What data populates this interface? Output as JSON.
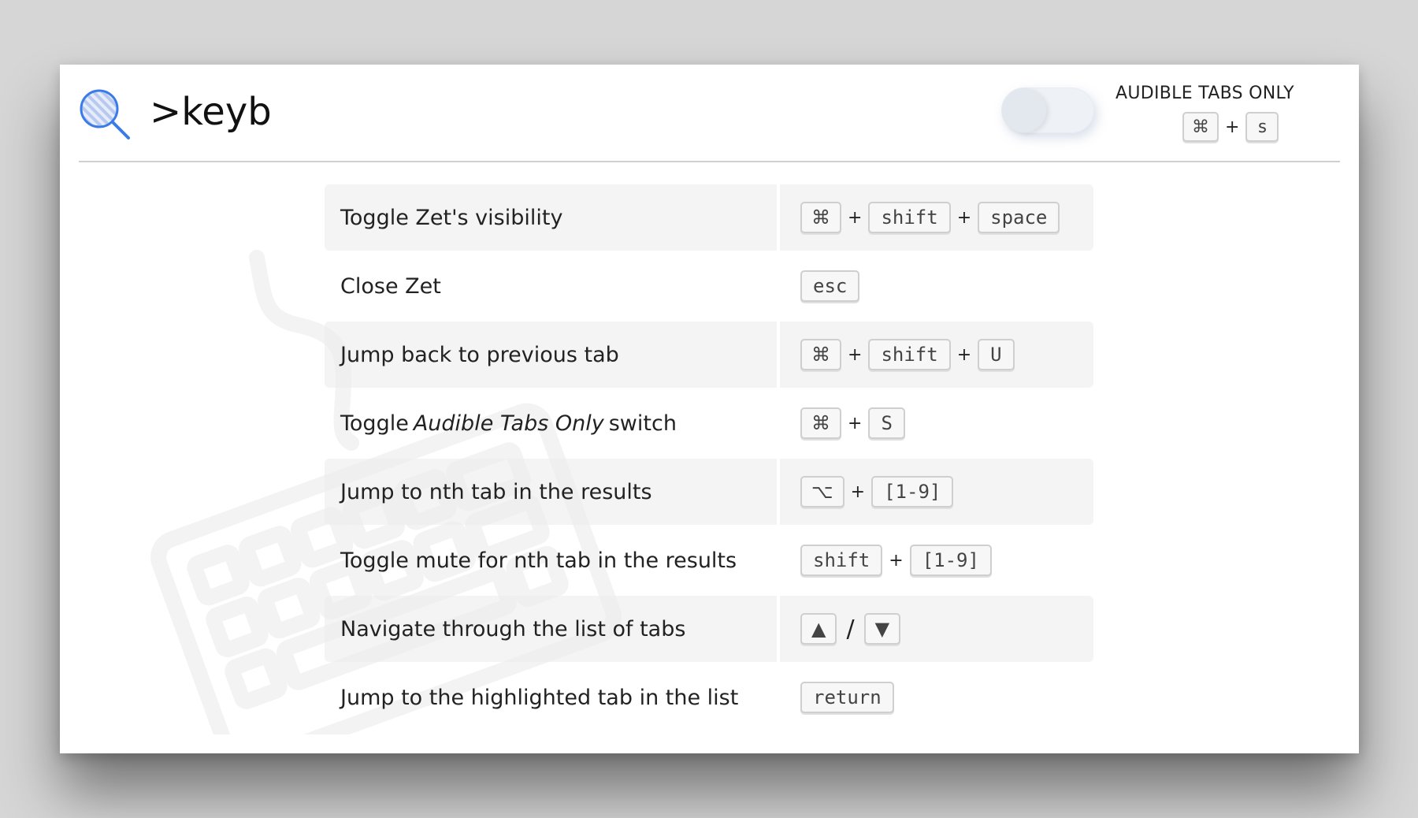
{
  "search": {
    "query": ">keyb"
  },
  "audible": {
    "label": "AUDIBLE TABS ONLY",
    "shortcut": [
      "⌘",
      "s"
    ],
    "plus": "+"
  },
  "shortcuts": [
    {
      "pre": "Toggle Zet's visibility",
      "em": "",
      "post": "",
      "keys": [
        "⌘",
        "+",
        "shift",
        "+",
        "space"
      ]
    },
    {
      "pre": "Close Zet",
      "em": "",
      "post": "",
      "keys": [
        "esc"
      ]
    },
    {
      "pre": "Jump back to previous tab",
      "em": "",
      "post": "",
      "keys": [
        "⌘",
        "+",
        "shift",
        "+",
        "U"
      ]
    },
    {
      "pre": "Toggle",
      "em": "Audible Tabs Only",
      "post": "switch",
      "keys": [
        "⌘",
        "+",
        "S"
      ]
    },
    {
      "pre": "Jump to nth tab in the results",
      "em": "",
      "post": "",
      "keys": [
        "⌥",
        "+",
        "[1-9]"
      ]
    },
    {
      "pre": "Toggle mute for nth tab in the results",
      "em": "",
      "post": "",
      "keys": [
        "shift",
        "+",
        "[1-9]"
      ]
    },
    {
      "pre": "Navigate through the list of tabs",
      "em": "",
      "post": "",
      "keys": [
        "▲",
        "/",
        "▼"
      ]
    },
    {
      "pre": "Jump to the highlighted tab in the list",
      "em": "",
      "post": "",
      "keys": [
        "return"
      ]
    }
  ],
  "colors": {
    "accent": "#3b7be8",
    "row_shade": "#f2f2f2",
    "key_border": "#cfcfcf"
  },
  "icons": {
    "search": "magnifier-icon",
    "watermark": "keyboard-icon"
  }
}
